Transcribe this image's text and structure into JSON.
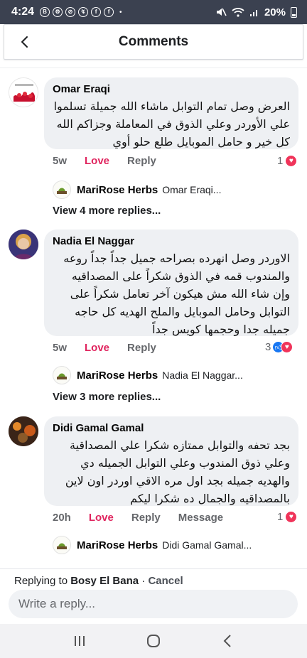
{
  "status_bar": {
    "time": "4:24",
    "battery": "20%",
    "dot": "•"
  },
  "header": {
    "title": "Comments"
  },
  "comments": [
    {
      "name": "Omar Eraqi",
      "text": "العرض وصل تمام التوابل ماشاء الله جميلة تسلموا علي الأوردر وعلي الذوق في المعاملة وجزاكم الله كل  خير و حامل الموبايل طلع حلو أوي",
      "time": "5w",
      "love": "Love",
      "reply": "Reply",
      "reactions": "1",
      "reply_preview": {
        "name": "MariRose Herbs",
        "text": "Omar Eraqi..."
      },
      "view_more": "View 4 more replies..."
    },
    {
      "name": "Nadia El Naggar",
      "text": "الاوردر وصل انهرده بصراحه جميل جداً جداً روعه والمندوب قمه في الذوق شكراً على المصداقيه وإن شاء الله مش هيكون آخر تعامل شكراً على التوابل وحامل الموبايل والملح الهديه كل حاجه جميله جدا وحجمها كويس جداً",
      "time": "5w",
      "love": "Love",
      "reply": "Reply",
      "reactions": "3",
      "reply_preview": {
        "name": "MariRose Herbs",
        "text": "Nadia El Naggar..."
      },
      "view_more": "View 3 more replies..."
    },
    {
      "name": "Didi Gamal Gamal",
      "text": "بجد تحفه والتوابل ممتازه شكرا علي المصداقية  وعلي ذوق المندوب وعلي التوابل الجميله  دي والهديه جميله بجد اول مره الاقي اوردر اون لاين بالمصداقيه والجمال ده شكرا ليكم",
      "time": "20h",
      "love": "Love",
      "reply": "Reply",
      "message": "Message",
      "reactions": "1",
      "reply_preview": {
        "name": "MariRose Herbs",
        "text": "Didi Gamal Gamal..."
      }
    }
  ],
  "composer": {
    "replying_prefix": "Replying to",
    "replying_name": "Bosy El Bana",
    "separator": "·",
    "cancel": "Cancel",
    "placeholder": "Write a reply..."
  },
  "colors": {
    "love": "#e0245e",
    "status_bar": "#3b4150",
    "bubble": "#eef0f3",
    "like": "#1877f2"
  }
}
